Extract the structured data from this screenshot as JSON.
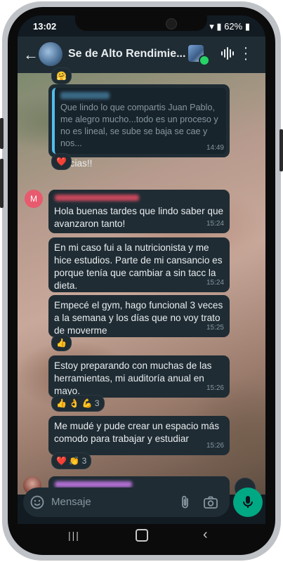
{
  "status_bar": {
    "time": "13:02",
    "battery": "62%"
  },
  "header": {
    "title": "Se de Alto Rendimie..."
  },
  "messages": [
    {
      "type": "incoming_quote",
      "quote_text": "Que lindo lo que compartis Juan Pablo, me alegro mucho...todo es un proceso y no es lineal, se sube se baja se cae y nos...",
      "text": "Gracias!!",
      "time": "14:49",
      "reactions": {
        "emoji": "❤️"
      }
    },
    {
      "avatar_letter": "M",
      "text": "Hola buenas tardes que lindo saber que avanzaron tanto!",
      "time": "15:24"
    },
    {
      "text": "En mi caso fui a la nutricionista y me hice estudios. Parte de mi cansancio es porque tenía que cambiar a sin tacc la dieta.",
      "time": "15:24"
    },
    {
      "text": "Empecé el gym, hago funcional 3 veces a la semana y los días que no voy trato de moverme",
      "time": "15:25",
      "reactions": {
        "emoji": "👍"
      }
    },
    {
      "text": "Estoy preparando con muchas de las herramientas, mi auditoría anual en mayo.",
      "time": "15:26",
      "reactions": {
        "emoji": "👍 👌 💪",
        "count": "3"
      }
    },
    {
      "text": "Me mudé y pude crear un espacio más comodo para trabajar y estudiar",
      "time": "15:26",
      "reactions": {
        "emoji": "❤️ 👏",
        "count": "3"
      }
    }
  ],
  "compose": {
    "placeholder": "Mensaje"
  },
  "colors": {
    "accent": "#00a884",
    "bubble": "#1f2c34",
    "header": "#1f2c34",
    "quote_bar": "#53bdeb"
  }
}
